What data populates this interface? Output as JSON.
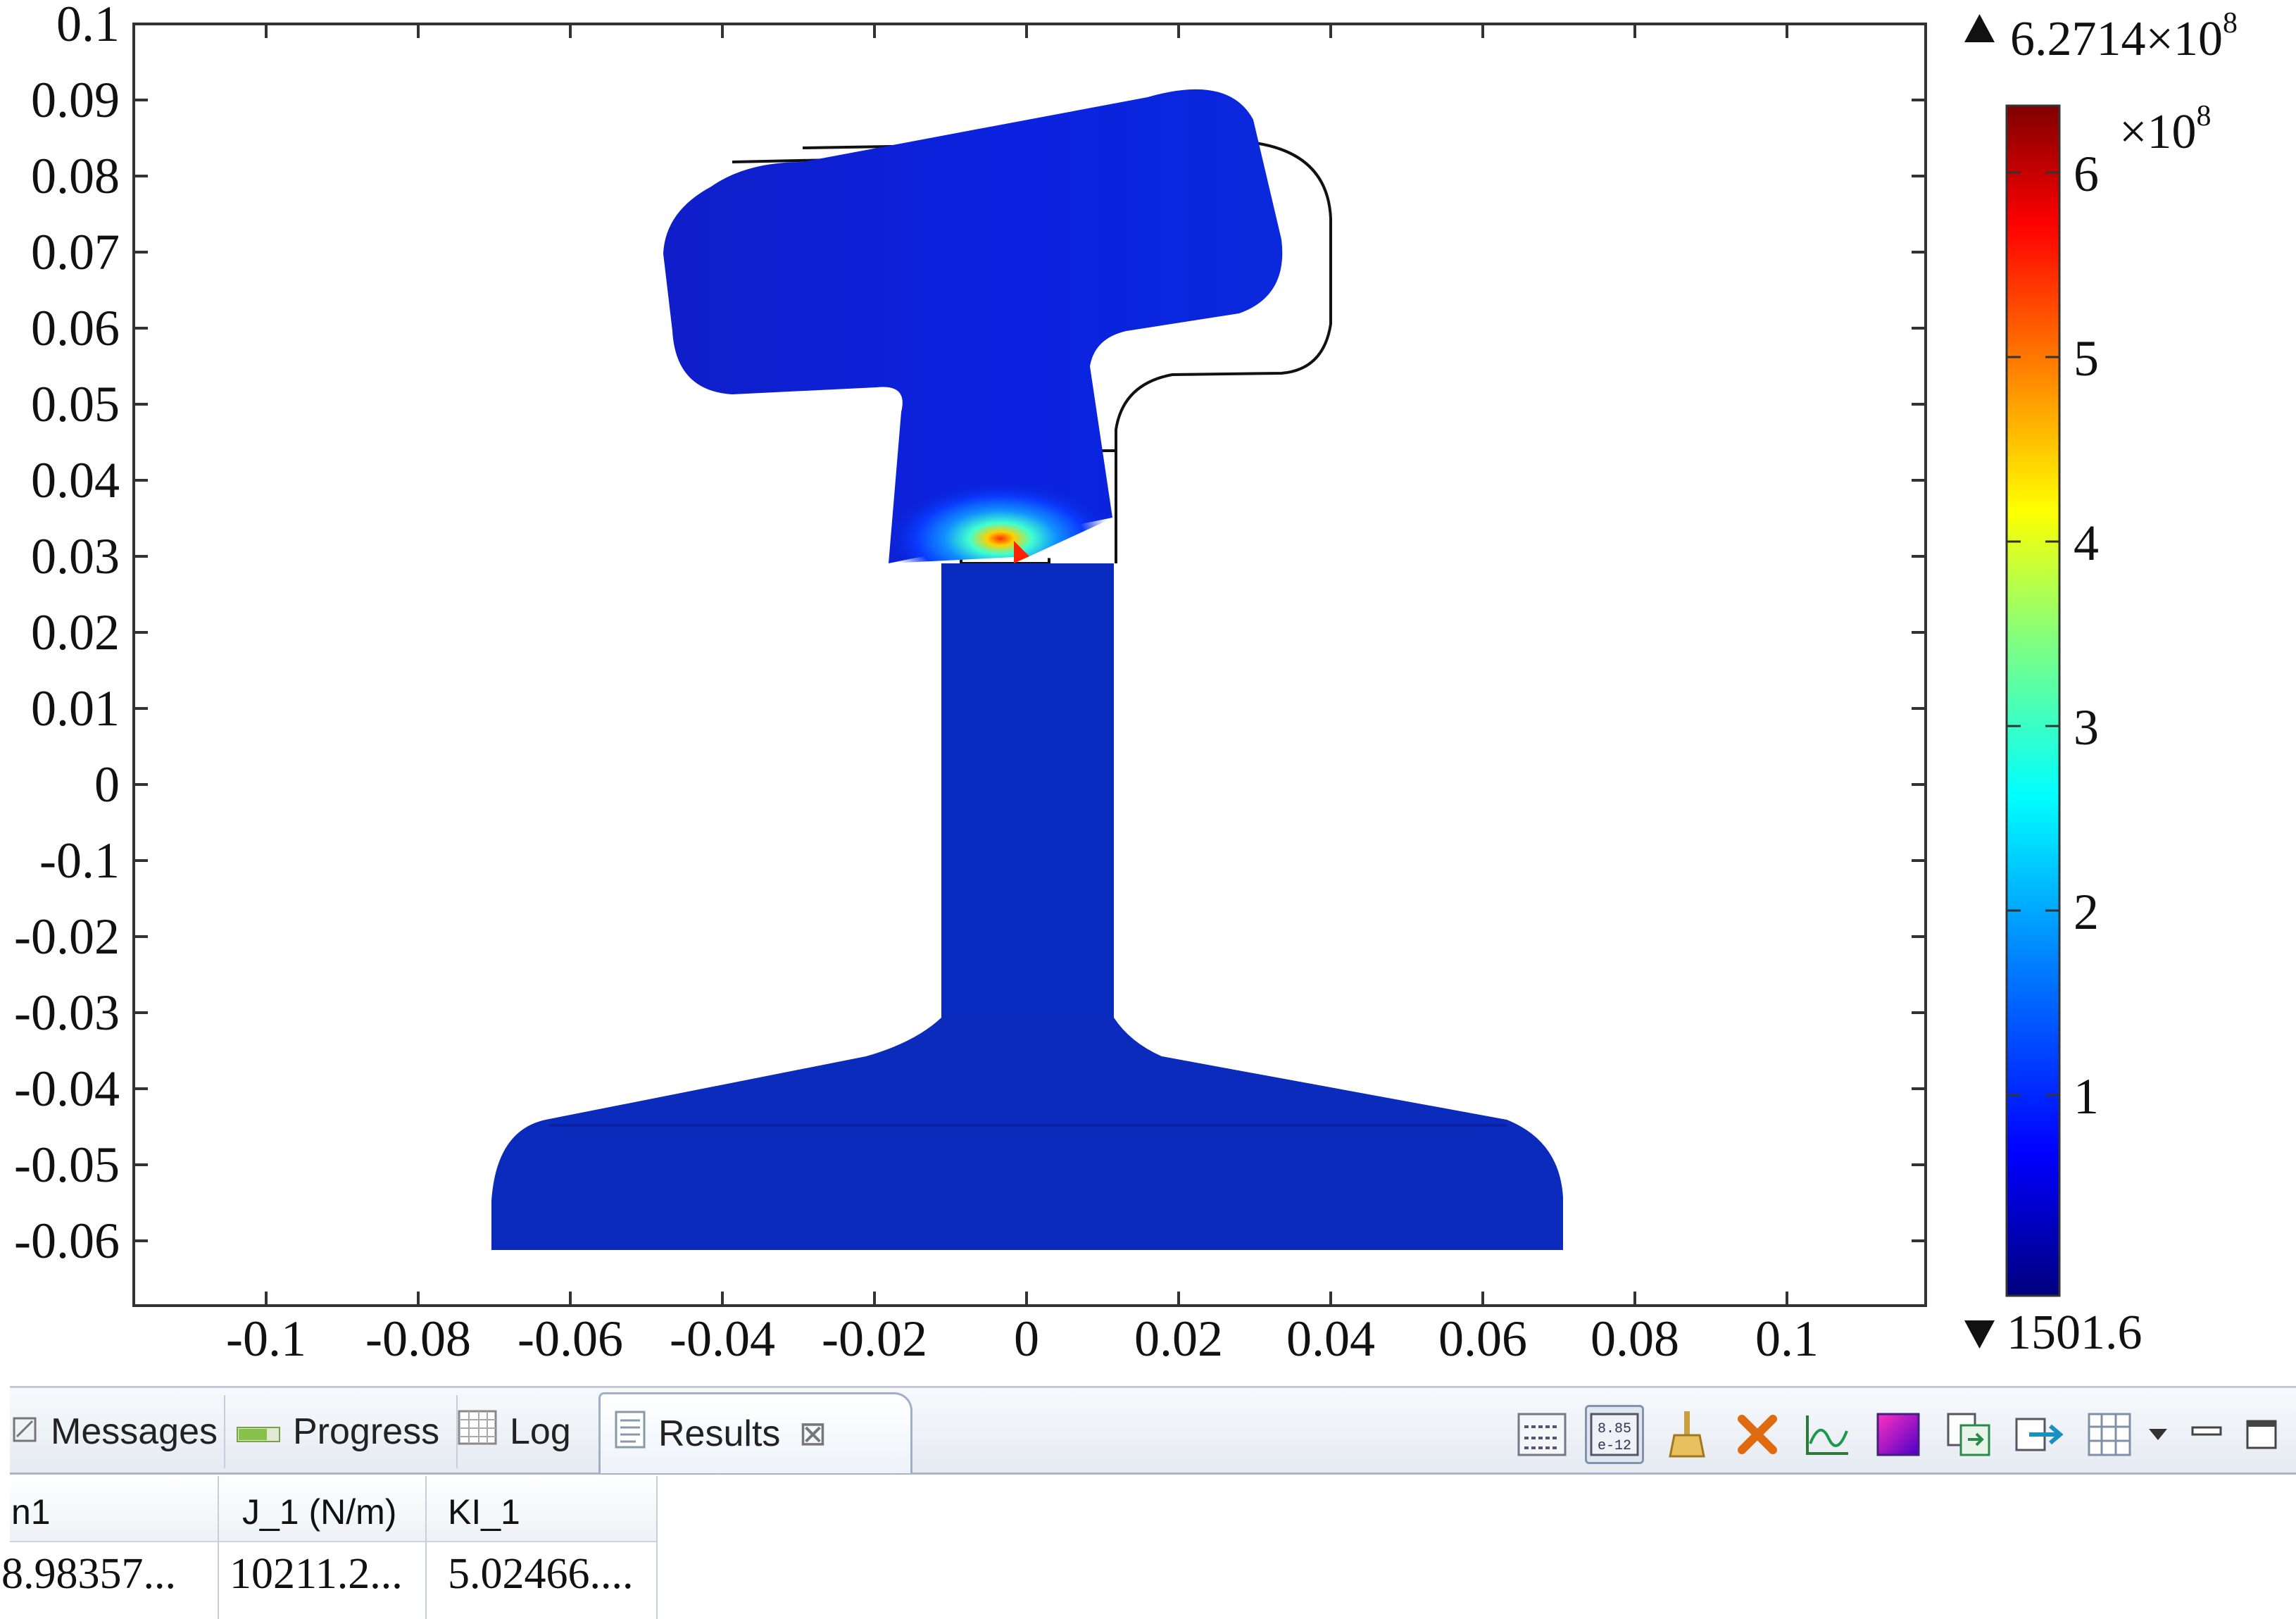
{
  "plot": {
    "y_ticks": [
      "0.1",
      "0.09",
      "0.08",
      "0.07",
      "0.06",
      "0.05",
      "0.04",
      "0.03",
      "0.02",
      "0.01",
      "0",
      "-0.1",
      "-0.02",
      "-0.03",
      "-0.04",
      "-0.05",
      "-0.06"
    ],
    "x_ticks": [
      "-0.1",
      "-0.08",
      "-0.06",
      "-0.04",
      "-0.02",
      "0",
      "0.02",
      "0.04",
      "0.06",
      "0.08",
      "0.1"
    ]
  },
  "colorbar": {
    "max_label": "6.2714×10",
    "max_exp": "8",
    "min_label": "1501.6",
    "scale_label": "×10",
    "scale_exp": "8",
    "ticks": [
      "6",
      "5",
      "4",
      "3",
      "2",
      "1"
    ],
    "colors": [
      "#00007f",
      "#0000ff",
      "#0080ff",
      "#00ffff",
      "#80ff80",
      "#ffff00",
      "#ff8000",
      "#ff0000",
      "#7f0000"
    ]
  },
  "panel": {
    "tabs": [
      {
        "label": "Messages",
        "icon": "messages-icon"
      },
      {
        "label": "Progress",
        "icon": "progress-icon"
      },
      {
        "label": "Log",
        "icon": "log-icon"
      },
      {
        "label": "Results",
        "icon": "results-icon",
        "close": "⊠"
      }
    ],
    "toolbar_number_icon_text": [
      "8.85",
      "e-12"
    ],
    "table": {
      "headers": [
        "n1",
        "J_1 (N/m)",
        "KI_1"
      ],
      "values": [
        "8.98357...",
        "10211.2...",
        "5.02466...."
      ]
    }
  }
}
